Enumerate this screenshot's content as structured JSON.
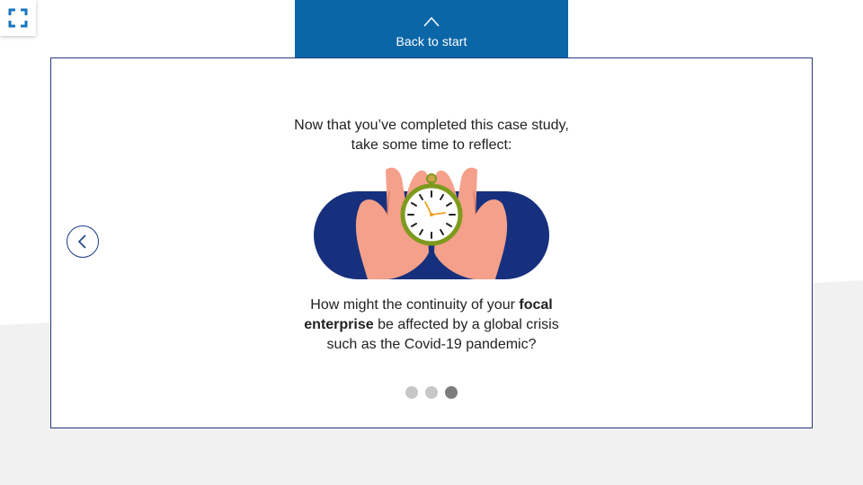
{
  "header": {
    "back_label": "Back to start"
  },
  "slide": {
    "intro_line1": "Now that you’ve completed this case study,",
    "intro_line2": "take some time to reflect:",
    "question_part1": "How might the continuity of your ",
    "question_bold": "focal enterprise",
    "question_part2": " be affected by a global crisis such as the Covid-19 pandemic?"
  },
  "pagination": {
    "total": 3,
    "active_index": 2
  },
  "icons": {
    "fullscreen": "fullscreen-icon",
    "back": "chevron-up-icon",
    "prev": "chevron-left-icon",
    "illustration": "stopwatch-in-hands-illustration"
  },
  "colors": {
    "accent": "#0b66a8",
    "navy": "#17307e",
    "card_border": "#243a7a",
    "skin": "#f5a08a",
    "watch_rim": "#7d9a1d"
  }
}
